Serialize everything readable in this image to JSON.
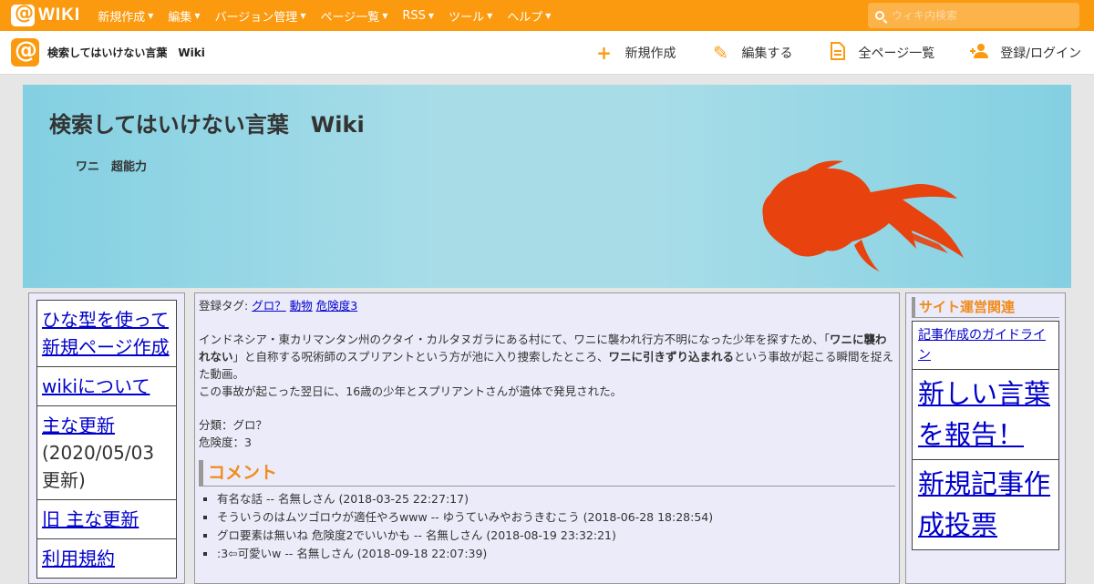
{
  "topbar": {
    "logo_text": "WIKI",
    "menu": [
      "新規作成",
      "編集",
      "バージョン管理",
      "ページ一覧",
      "RSS",
      "ツール",
      "ヘルプ"
    ],
    "search_placeholder": "ウィキ内検索"
  },
  "subbar": {
    "site_name": "検索してはいけない言葉　Wiki",
    "actions": [
      {
        "icon": "plus-icon",
        "label": "新規作成"
      },
      {
        "icon": "pencil-icon",
        "label": "編集する"
      },
      {
        "icon": "document-icon",
        "label": "全ページ一覧"
      },
      {
        "icon": "user-add-icon",
        "label": "登録/ログイン"
      }
    ]
  },
  "banner": {
    "title": "検索してはいけない言葉　Wiki",
    "subtitle": "ワニ　超能力",
    "colors": {
      "fish": "#e8420f",
      "sky": "#83d0e2"
    }
  },
  "left_menu": {
    "items": [
      "ひな型を使って新規ページ作成",
      "wikiについて",
      {
        "link": "主な更新",
        "note": "(2020/05/03更新)"
      },
      "旧 主な更新",
      "利用規約"
    ]
  },
  "main": {
    "tags_label": "登録タグ:",
    "tags": [
      "グロ？",
      "動物",
      "危険度3"
    ],
    "paragraph1_a": "インドネシア・東カリマンタン州のクタイ・カルタヌガラにある村にて、ワニに襲われ行方不明になった少年を探すため、「",
    "paragraph1_b": "ワニに襲われない",
    "paragraph1_c": "」と自称する呪術師のスプリアントという方が池に入り捜索したところ、",
    "paragraph1_d": "ワニに引きずり込まれる",
    "paragraph1_e": "という事故が起こる瞬間を捉えた動画。",
    "paragraph2": "この事故が起こった翌日に、16歳の少年とスプリアントさんが遺体で発見された。",
    "category": "分類：グロ？",
    "danger": "危険度：3",
    "comments_heading": "コメント",
    "comments": [
      "有名な話 -- 名無しさん (2018-03-25 22:27:17)",
      "そういうのはムツゴロウが適任やろwww -- ゆうていみやおうきむこう (2018-06-28 18:28:54)",
      "グロ要素は無いね 危険度2でいいかも -- 名無しさん (2018-08-19 23:32:21)",
      ":3⇦可愛いw -- 名無しさん (2018-09-18 22:07:39)"
    ]
  },
  "right_menu": {
    "heading": "サイト運営関連",
    "items": [
      "記事作成のガイドライン",
      "新しい言葉を報告！",
      "新規記事作成投票"
    ]
  }
}
